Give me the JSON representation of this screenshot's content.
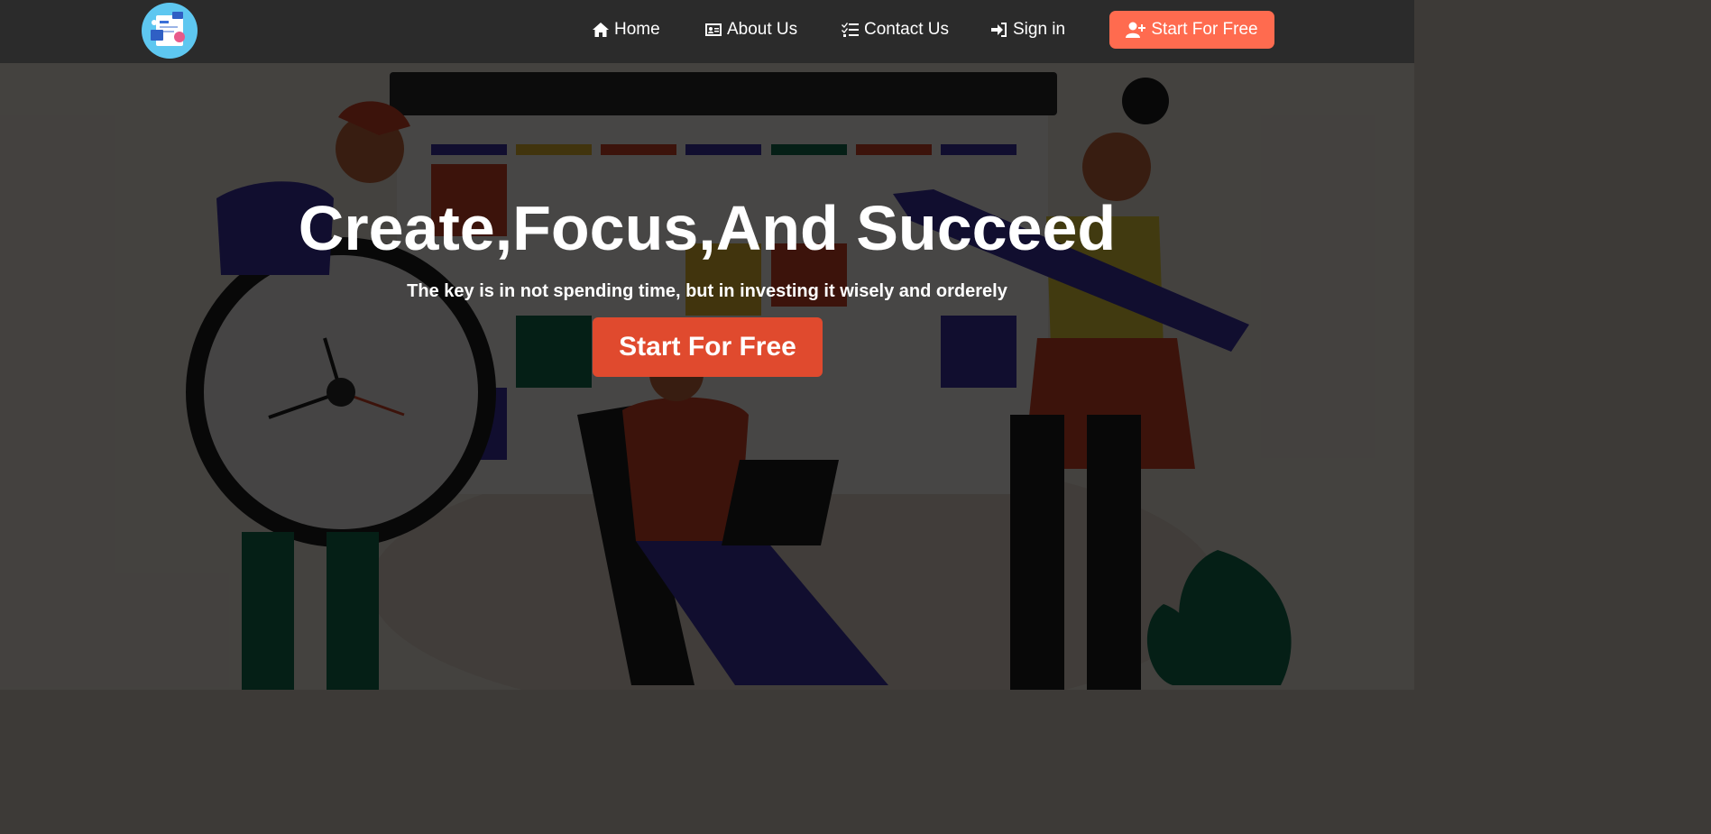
{
  "nav": {
    "logo": "app-logo",
    "links": [
      {
        "label": "Home",
        "icon": "home-icon"
      },
      {
        "label": "About Us",
        "icon": "id-card-icon"
      },
      {
        "label": "Contact Us",
        "icon": "checklist-icon"
      },
      {
        "label": "Sign in",
        "icon": "sign-in-icon"
      }
    ],
    "cta": {
      "label": "Start For Free",
      "icon": "user-plus-icon"
    }
  },
  "hero": {
    "headline": "Create,Focus,And Succeed",
    "tagline": "The key is in not spending time, but in investing it wisely and orderely",
    "cta_label": "Start For Free"
  },
  "colors": {
    "navbar": "#2b2b2b",
    "nav_cta": "#ff6b4f",
    "hero_cta": "#e04a2e",
    "logo_bg": "#5ec7f0"
  }
}
